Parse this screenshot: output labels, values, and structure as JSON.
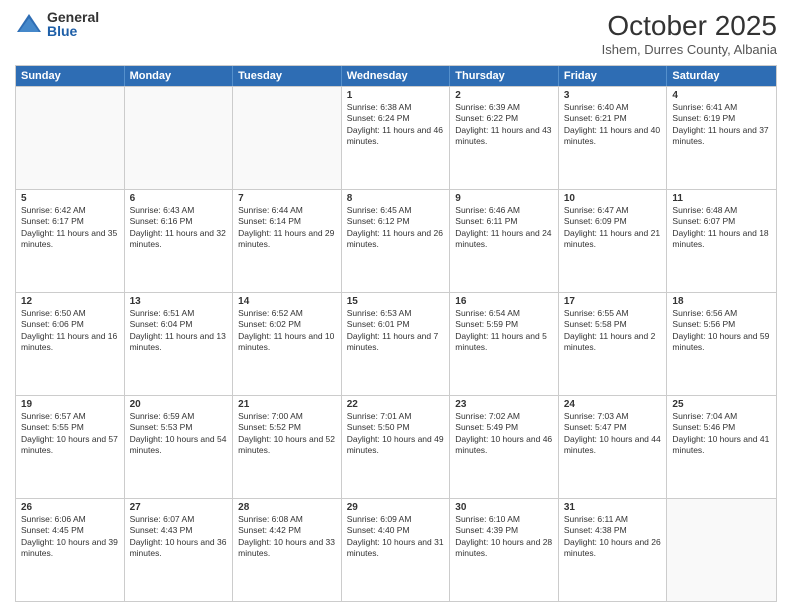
{
  "logo": {
    "general": "General",
    "blue": "Blue"
  },
  "header": {
    "month": "October 2025",
    "location": "Ishem, Durres County, Albania"
  },
  "days_of_week": [
    "Sunday",
    "Monday",
    "Tuesday",
    "Wednesday",
    "Thursday",
    "Friday",
    "Saturday"
  ],
  "weeks": [
    [
      {
        "day": "",
        "empty": true
      },
      {
        "day": "",
        "empty": true
      },
      {
        "day": "",
        "empty": true
      },
      {
        "day": "1",
        "sunrise": "6:38 AM",
        "sunset": "6:24 PM",
        "daylight": "11 hours and 46 minutes."
      },
      {
        "day": "2",
        "sunrise": "6:39 AM",
        "sunset": "6:22 PM",
        "daylight": "11 hours and 43 minutes."
      },
      {
        "day": "3",
        "sunrise": "6:40 AM",
        "sunset": "6:21 PM",
        "daylight": "11 hours and 40 minutes."
      },
      {
        "day": "4",
        "sunrise": "6:41 AM",
        "sunset": "6:19 PM",
        "daylight": "11 hours and 37 minutes."
      }
    ],
    [
      {
        "day": "5",
        "sunrise": "6:42 AM",
        "sunset": "6:17 PM",
        "daylight": "11 hours and 35 minutes."
      },
      {
        "day": "6",
        "sunrise": "6:43 AM",
        "sunset": "6:16 PM",
        "daylight": "11 hours and 32 minutes."
      },
      {
        "day": "7",
        "sunrise": "6:44 AM",
        "sunset": "6:14 PM",
        "daylight": "11 hours and 29 minutes."
      },
      {
        "day": "8",
        "sunrise": "6:45 AM",
        "sunset": "6:12 PM",
        "daylight": "11 hours and 26 minutes."
      },
      {
        "day": "9",
        "sunrise": "6:46 AM",
        "sunset": "6:11 PM",
        "daylight": "11 hours and 24 minutes."
      },
      {
        "day": "10",
        "sunrise": "6:47 AM",
        "sunset": "6:09 PM",
        "daylight": "11 hours and 21 minutes."
      },
      {
        "day": "11",
        "sunrise": "6:48 AM",
        "sunset": "6:07 PM",
        "daylight": "11 hours and 18 minutes."
      }
    ],
    [
      {
        "day": "12",
        "sunrise": "6:50 AM",
        "sunset": "6:06 PM",
        "daylight": "11 hours and 16 minutes."
      },
      {
        "day": "13",
        "sunrise": "6:51 AM",
        "sunset": "6:04 PM",
        "daylight": "11 hours and 13 minutes."
      },
      {
        "day": "14",
        "sunrise": "6:52 AM",
        "sunset": "6:02 PM",
        "daylight": "11 hours and 10 minutes."
      },
      {
        "day": "15",
        "sunrise": "6:53 AM",
        "sunset": "6:01 PM",
        "daylight": "11 hours and 7 minutes."
      },
      {
        "day": "16",
        "sunrise": "6:54 AM",
        "sunset": "5:59 PM",
        "daylight": "11 hours and 5 minutes."
      },
      {
        "day": "17",
        "sunrise": "6:55 AM",
        "sunset": "5:58 PM",
        "daylight": "11 hours and 2 minutes."
      },
      {
        "day": "18",
        "sunrise": "6:56 AM",
        "sunset": "5:56 PM",
        "daylight": "10 hours and 59 minutes."
      }
    ],
    [
      {
        "day": "19",
        "sunrise": "6:57 AM",
        "sunset": "5:55 PM",
        "daylight": "10 hours and 57 minutes."
      },
      {
        "day": "20",
        "sunrise": "6:59 AM",
        "sunset": "5:53 PM",
        "daylight": "10 hours and 54 minutes."
      },
      {
        "day": "21",
        "sunrise": "7:00 AM",
        "sunset": "5:52 PM",
        "daylight": "10 hours and 52 minutes."
      },
      {
        "day": "22",
        "sunrise": "7:01 AM",
        "sunset": "5:50 PM",
        "daylight": "10 hours and 49 minutes."
      },
      {
        "day": "23",
        "sunrise": "7:02 AM",
        "sunset": "5:49 PM",
        "daylight": "10 hours and 46 minutes."
      },
      {
        "day": "24",
        "sunrise": "7:03 AM",
        "sunset": "5:47 PM",
        "daylight": "10 hours and 44 minutes."
      },
      {
        "day": "25",
        "sunrise": "7:04 AM",
        "sunset": "5:46 PM",
        "daylight": "10 hours and 41 minutes."
      }
    ],
    [
      {
        "day": "26",
        "sunrise": "6:06 AM",
        "sunset": "4:45 PM",
        "daylight": "10 hours and 39 minutes."
      },
      {
        "day": "27",
        "sunrise": "6:07 AM",
        "sunset": "4:43 PM",
        "daylight": "10 hours and 36 minutes."
      },
      {
        "day": "28",
        "sunrise": "6:08 AM",
        "sunset": "4:42 PM",
        "daylight": "10 hours and 33 minutes."
      },
      {
        "day": "29",
        "sunrise": "6:09 AM",
        "sunset": "4:40 PM",
        "daylight": "10 hours and 31 minutes."
      },
      {
        "day": "30",
        "sunrise": "6:10 AM",
        "sunset": "4:39 PM",
        "daylight": "10 hours and 28 minutes."
      },
      {
        "day": "31",
        "sunrise": "6:11 AM",
        "sunset": "4:38 PM",
        "daylight": "10 hours and 26 minutes."
      },
      {
        "day": "",
        "empty": true
      }
    ]
  ]
}
